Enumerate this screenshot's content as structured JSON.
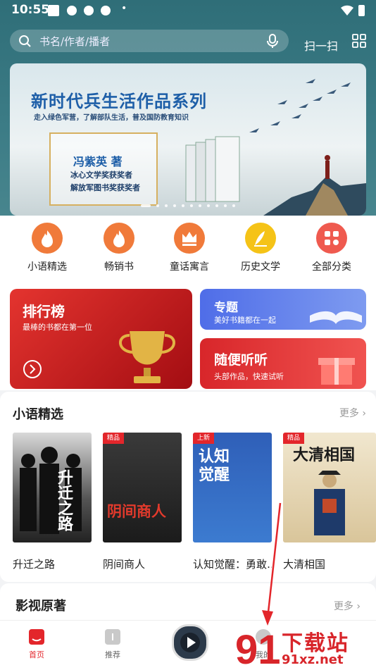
{
  "status": {
    "time": "10:55"
  },
  "search": {
    "placeholder": "书名/作者/播者",
    "scan_label": "扫一扫"
  },
  "banner": {
    "title": "新时代兵生活作品系列",
    "subtitle": "走入绿色军营，了解部队生活，普及国防教育知识",
    "author": "冯紫英  著",
    "award1": "冰心文学奖获奖者",
    "award2": "解放军图书奖获奖者"
  },
  "categories": [
    {
      "label": "小语精选",
      "color": "#f07a3a",
      "icon": "flame-icon"
    },
    {
      "label": "畅销书",
      "color": "#f07a3a",
      "icon": "flame-icon"
    },
    {
      "label": "童话寓言",
      "color": "#f07a3a",
      "icon": "crown-icon"
    },
    {
      "label": "历史文学",
      "color": "#f5c317",
      "icon": "quill-icon"
    },
    {
      "label": "全部分类",
      "color": "#ef5a4f",
      "icon": "grid-icon"
    }
  ],
  "cards": {
    "rank": {
      "title": "排行榜",
      "sub": "最棒的书都在第一位"
    },
    "topic": {
      "title": "专题",
      "sub": "美好书籍都在一起"
    },
    "listen": {
      "title": "随便听听",
      "sub": "头部作品，快速试听"
    }
  },
  "section1": {
    "title": "小语精选",
    "more": "更多 ›",
    "books": [
      {
        "name": "升迁之路",
        "cover_title": "升迁之路",
        "tag": ""
      },
      {
        "name": "阴间商人",
        "cover_title": "阴间商人",
        "tag": "精品"
      },
      {
        "name": "认知觉醒：勇敢…",
        "cover_title": "认知觉醒",
        "tag": "上新"
      },
      {
        "name": "大清相国",
        "cover_title": "大清相国",
        "tag": "精品"
      }
    ]
  },
  "section2": {
    "title": "影视原著",
    "more": "更多 ›"
  },
  "nav": {
    "home": "首页",
    "recommend": "推荐",
    "mine": "我的"
  },
  "watermark": {
    "text": "下载站",
    "domain": "91xz.net"
  },
  "colors": {
    "accent": "#e3262b",
    "topbg": "#3c7c86"
  }
}
